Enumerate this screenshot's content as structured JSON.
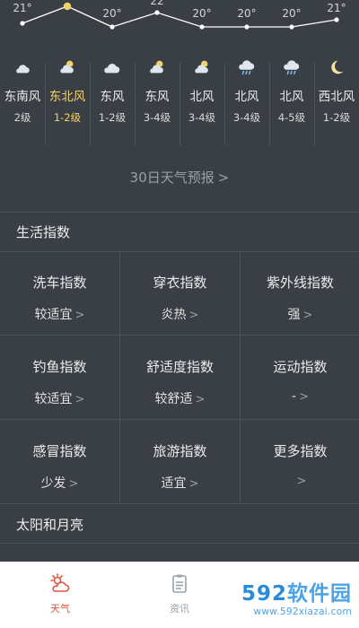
{
  "hourly": {
    "temps": [
      "21°",
      "",
      "20°",
      "22",
      "20°",
      "20°",
      "20°",
      "21°"
    ],
    "columns": [
      {
        "icon": "cloudy-night-icon",
        "wind": "东南风",
        "level": "2级",
        "active": false
      },
      {
        "icon": "partly-cloudy-icon",
        "wind": "东北风",
        "level": "1-2级",
        "active": true
      },
      {
        "icon": "cloudy-icon",
        "wind": "东风",
        "level": "1-2级",
        "active": false
      },
      {
        "icon": "partly-cloudy-icon",
        "wind": "东风",
        "level": "3-4级",
        "active": false
      },
      {
        "icon": "partly-cloudy-icon",
        "wind": "北风",
        "level": "3-4级",
        "active": false
      },
      {
        "icon": "rain-icon",
        "wind": "北风",
        "level": "3-4级",
        "active": false
      },
      {
        "icon": "rain-icon",
        "wind": "北风",
        "level": "4-5级",
        "active": false
      },
      {
        "icon": "moon-icon",
        "wind": "西北风",
        "level": "1-2级",
        "active": false
      }
    ]
  },
  "forecast": {
    "label": "30日天气预报",
    "chev": ">"
  },
  "life": {
    "title": "生活指数",
    "cells": [
      {
        "title": "洗车指数",
        "value": "较适宜"
      },
      {
        "title": "穿衣指数",
        "value": "炎热"
      },
      {
        "title": "紫外线指数",
        "value": "强"
      },
      {
        "title": "钓鱼指数",
        "value": "较适宜"
      },
      {
        "title": "舒适度指数",
        "value": "较舒适"
      },
      {
        "title": "运动指数",
        "value": "-"
      },
      {
        "title": "感冒指数",
        "value": "少发"
      },
      {
        "title": "旅游指数",
        "value": "适宜"
      },
      {
        "title": "更多指数",
        "value": ""
      }
    ],
    "chev": ">"
  },
  "sun_moon": {
    "title": "太阳和月亮"
  },
  "nav": {
    "weather": "天气",
    "news": "资讯"
  },
  "watermark": {
    "num": "592",
    "cn": "软件园",
    "url": "www.592xiazai.com"
  },
  "colors": {
    "accent": "#f2d36b",
    "nav_active": "#e2533d",
    "bg": "#3a3e45"
  }
}
